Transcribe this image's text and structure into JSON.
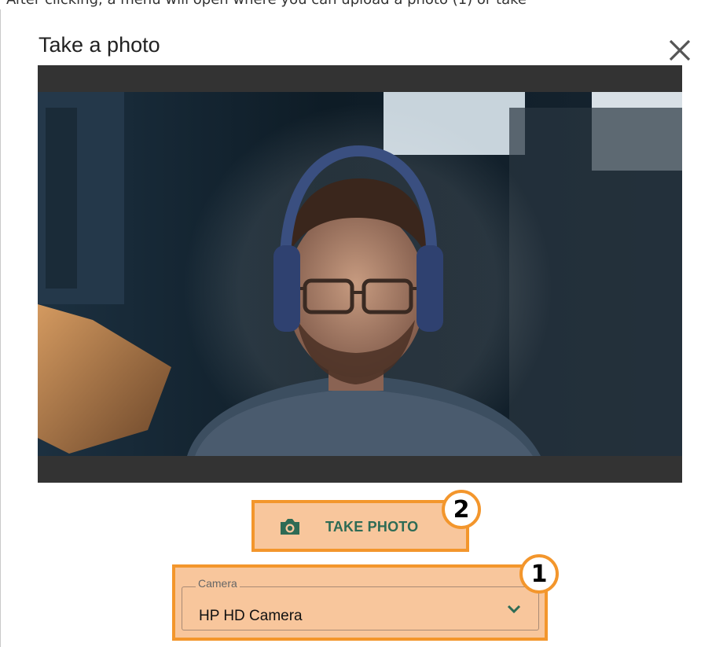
{
  "caption": "After clicking, a menu will open where you can upload a photo (1) or take",
  "dialog": {
    "title": "Take a photo",
    "close_icon": "close-icon"
  },
  "preview": {
    "alt": "webcam preview"
  },
  "take_photo": {
    "label": "TAKE PHOTO",
    "icon": "camera-icon"
  },
  "camera_select": {
    "legend": "Camera",
    "value": "HP HD Camera",
    "icon": "chevron-down-icon"
  },
  "badges": {
    "one": "1",
    "two": "2"
  },
  "colors": {
    "highlight_border": "#f3962c",
    "highlight_fill": "#f8c69c",
    "accent_green": "#2e6b55"
  }
}
